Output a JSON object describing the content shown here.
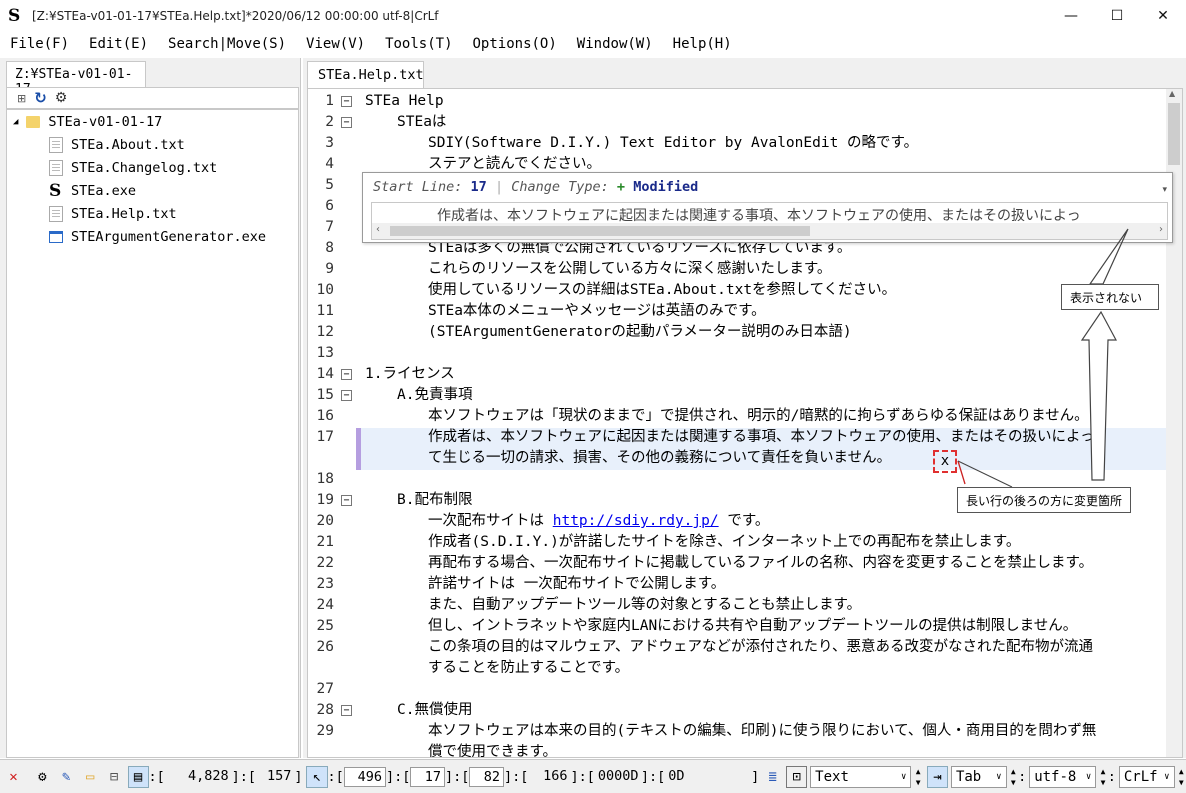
{
  "window": {
    "title": "[Z:¥STEa-v01-01-17¥STEa.Help.txt]*2020/06/12 00:00:00 utf-8|CrLf",
    "minimize": "—",
    "maximize": "☐",
    "close": "✕"
  },
  "menu": [
    "File(F)",
    "Edit(E)",
    "Search|Move(S)",
    "View(V)",
    "Tools(T)",
    "Options(O)",
    "Window(W)",
    "Help(H)"
  ],
  "explorer": {
    "tab": "Z:¥STEa-v01-01-17",
    "root": "STEa-v01-01-17",
    "files": [
      "STEa.About.txt",
      "STEa.Changelog.txt",
      "STEa.exe",
      "STEa.Help.txt",
      "STEArgumentGenerator.exe"
    ]
  },
  "editor": {
    "tab": "STEa.Help.txt",
    "lines": [
      {
        "n": "1",
        "indent": 0,
        "text": "STEa Help",
        "fold": "minus"
      },
      {
        "n": "2",
        "indent": 1,
        "text": "STEaは",
        "fold": "minus"
      },
      {
        "n": "3",
        "indent": 2,
        "text": "SDIY(Software D.I.Y.) Text Editor by AvalonEdit の略です。"
      },
      {
        "n": "4",
        "indent": 2,
        "text": "ステアと読んでください。"
      },
      {
        "n": "5",
        "indent": 2,
        "text": ""
      },
      {
        "n": "6",
        "indent": 2,
        "text": ""
      },
      {
        "n": "7",
        "indent": 2,
        "text": ""
      },
      {
        "n": "8",
        "indent": 2,
        "text": "STEaは多くの無償で公開されているリソースに依存しています。"
      },
      {
        "n": "9",
        "indent": 2,
        "text": "これらのリソースを公開している方々に深く感謝いたします。"
      },
      {
        "n": "10",
        "indent": 2,
        "text": "使用しているリソースの詳細はSTEa.About.txtを参照してください。"
      },
      {
        "n": "11",
        "indent": 2,
        "text": "STEa本体のメニューやメッセージは英語のみです。"
      },
      {
        "n": "12",
        "indent": 2,
        "text": "(STEArgumentGeneratorの起動パラメーター説明のみ日本語)"
      },
      {
        "n": "13",
        "indent": 0,
        "text": ""
      },
      {
        "n": "14",
        "indent": 0,
        "text": "1.ライセンス",
        "fold": "minus"
      },
      {
        "n": "15",
        "indent": 1,
        "text": "A.免責事項",
        "fold": "minus"
      },
      {
        "n": "16",
        "indent": 2,
        "text": "本ソフトウェアは「現状のままで」で提供され、明示的/暗黙的に拘らずあらゆる保証はありません。"
      },
      {
        "n": "17",
        "indent": 2,
        "text": "作成者は、本ソフトウェアに起因または関連する事項、本ソフトウェアの使用、またはその扱いによっ"
      },
      {
        "n": "",
        "indent": 2,
        "text": "て生じる一切の請求、損害、その他の義務について責任を負いません。"
      },
      {
        "n": "18",
        "indent": 0,
        "text": ""
      },
      {
        "n": "19",
        "indent": 1,
        "text": "B.配布制限",
        "fold": "minus"
      },
      {
        "n": "20",
        "indent": 2,
        "text": "一次配布サイトは ",
        "link": "http://sdiy.rdy.jp/",
        "after": " です。"
      },
      {
        "n": "21",
        "indent": 2,
        "text": "作成者(S.D.I.Y.)が許諾したサイトを除き、インターネット上での再配布を禁止します。"
      },
      {
        "n": "22",
        "indent": 2,
        "text": "再配布する場合、一次配布サイトに掲載しているファイルの名称、内容を変更することを禁止します。"
      },
      {
        "n": "23",
        "indent": 2,
        "text": "許諾サイトは 一次配布サイトで公開します。"
      },
      {
        "n": "24",
        "indent": 2,
        "text": "また、自動アップデートツール等の対象とすることも禁止します。"
      },
      {
        "n": "25",
        "indent": 2,
        "text": "但し、イントラネットや家庭内LANにおける共有や自動アップデートツールの提供は制限しません。"
      },
      {
        "n": "26",
        "indent": 2,
        "text": "この条項の目的はマルウェア、アドウェアなどが添付されたり、悪意ある改変がなされた配布物が流通"
      },
      {
        "n": "",
        "indent": 2,
        "text": "することを防止することです。"
      },
      {
        "n": "27",
        "indent": 0,
        "text": ""
      },
      {
        "n": "28",
        "indent": 1,
        "text": "C.無償使用",
        "fold": "minus"
      },
      {
        "n": "29",
        "indent": 2,
        "text": "本ソフトウェアは本来の目的(テキストの編集、印刷)に使う限りにおいて、個人・商用目的を問わず無"
      },
      {
        "n": "",
        "indent": 2,
        "text": "償で使用できます。"
      }
    ]
  },
  "popup": {
    "start_label": "Start Line:",
    "start_value": "17",
    "change_label": "Change Type:",
    "change_sign": "+",
    "change_value": "Modified",
    "text": "作成者は、本ソフトウェアに起因または関連する事項、本ソフトウェアの使用、またはその扱いによっ"
  },
  "annotations": {
    "not_shown": "表示されない",
    "marker": "x",
    "late_change": "長い行の後ろの方に変更箇所"
  },
  "status": {
    "total_label": ":[",
    "total_chars": "4,828",
    "total_lines": "157",
    "caret_offset": "496",
    "line": "17",
    "column": "82",
    "char_code_dec": "166",
    "char_code_hex": "0000D",
    "char_hex": "0D",
    "syntax": "Text",
    "indent": "Tab",
    "encoding": "utf-8",
    "newline": "CrLf"
  },
  "colors": {
    "accent": "#1a2a8a",
    "change_bar": "#b59ee0",
    "highlight": "#e8f0fb",
    "marker_red": "#e03030",
    "add_green": "#2a8a2a"
  }
}
